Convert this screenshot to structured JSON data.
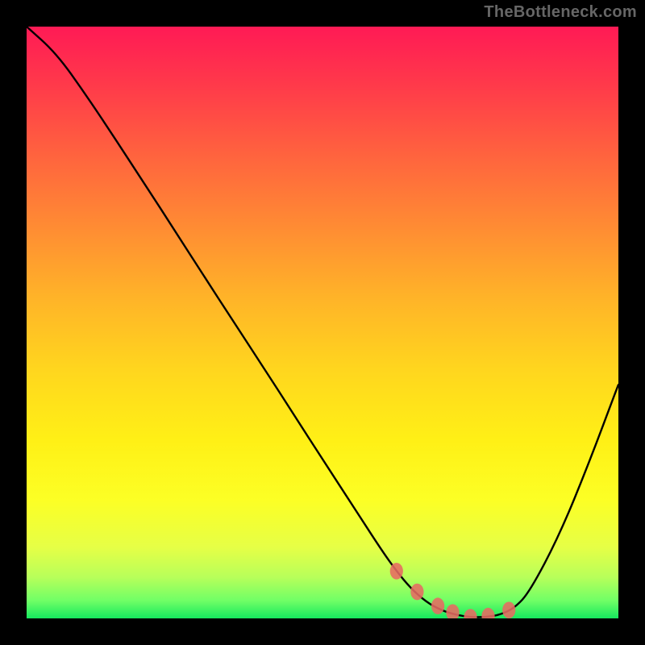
{
  "watermark": "TheBottleneck.com",
  "colors": {
    "curve_stroke": "#000000",
    "marker_fill": "#e76a62"
  },
  "chart_data": {
    "type": "line",
    "title": "",
    "xlabel": "",
    "ylabel": "",
    "xlim": [
      0,
      1
    ],
    "ylim": [
      0,
      1
    ],
    "grid": false,
    "series": [
      {
        "name": "bottleneck-curve",
        "x": [
          0.0,
          0.05,
          0.1,
          0.15,
          0.2,
          0.25,
          0.3,
          0.35,
          0.4,
          0.45,
          0.5,
          0.55,
          0.6,
          0.625,
          0.65,
          0.675,
          0.7,
          0.725,
          0.75,
          0.775,
          0.8,
          0.825,
          0.85,
          0.9,
          0.95,
          1.0
        ],
        "values": [
          1.0,
          0.955,
          0.885,
          0.81,
          0.733,
          0.656,
          0.578,
          0.501,
          0.424,
          0.347,
          0.269,
          0.192,
          0.115,
          0.08,
          0.05,
          0.028,
          0.014,
          0.006,
          0.002,
          0.002,
          0.006,
          0.018,
          0.045,
          0.14,
          0.262,
          0.395
        ]
      }
    ],
    "markers": {
      "name": "optimal-range",
      "points_x": [
        0.625,
        0.66,
        0.695,
        0.72,
        0.75,
        0.78,
        0.815
      ],
      "points_y": [
        0.08,
        0.045,
        0.021,
        0.01,
        0.002,
        0.004,
        0.014
      ],
      "rx": 0.011,
      "ry": 0.014
    }
  }
}
